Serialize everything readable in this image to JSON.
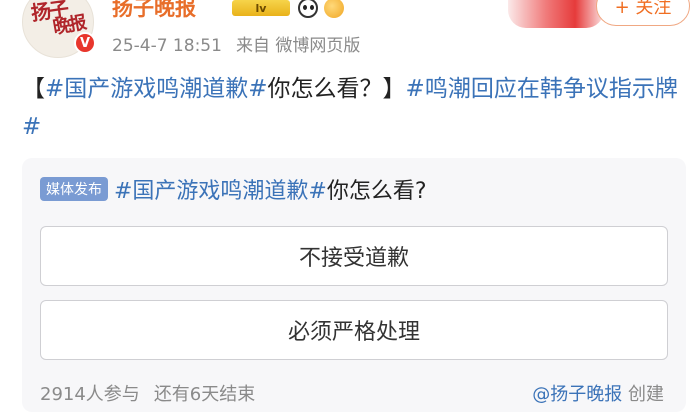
{
  "header": {
    "username": "扬子晚报",
    "level_badge": "lv",
    "timestamp": "25-4-7 18:51",
    "source": "来自 微博网页版",
    "follow_label": "+ 关注",
    "avatar_text_1": "扬子",
    "avatar_text_2": "晚报",
    "verified_badge": "V"
  },
  "post": {
    "bracket_open": "【",
    "tag1": "#国产游戏鸣潮道歉#",
    "text1": "你怎么看？】",
    "tag2": "#鸣潮回应在韩争议指示牌#"
  },
  "poll": {
    "badge": "媒体发布",
    "question_tag": "#国产游戏鸣潮道歉#",
    "question_text": "你怎么看?",
    "options": [
      {
        "label": "不接受道歉"
      },
      {
        "label": "必须严格处理"
      }
    ],
    "participants": "2914人参与",
    "remaining": "还有6天结束",
    "creator_author": "@扬子晚报",
    "creator_suffix": "创建"
  },
  "colors": {
    "tag": "#3b73b8",
    "username": "#e86e2a",
    "follow": "#f06e22",
    "media_badge": "#7a9bd3",
    "verified": "#e8362c"
  },
  "icons": {
    "verified": "verified-v-icon",
    "level": "level-badge-icon",
    "emoji1": "panda-icon",
    "emoji2": "gold-emoji-icon"
  }
}
